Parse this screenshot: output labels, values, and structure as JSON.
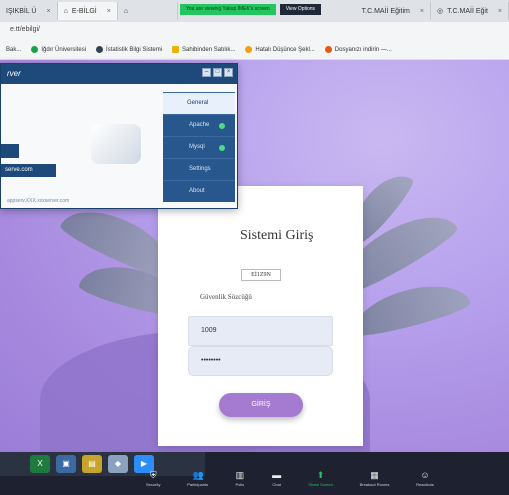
{
  "browser": {
    "tabs": [
      {
        "label": "IŞIKBİL Ü",
        "active": false
      },
      {
        "label": "E-BİLGİ",
        "active": true
      },
      {
        "label": "",
        "active": false
      },
      {
        "label": "T.C.MAİİ Eğitim",
        "active": false
      },
      {
        "label": "T.C.MAİİ Eğit",
        "active": false
      }
    ],
    "share_banner": {
      "message": "You are viewing Yakup İMEK's screen",
      "button": "View Options"
    },
    "url": "e.tt/ebilgi/",
    "bookmarks": [
      {
        "label": "Bak...",
        "color": "#1a73e8"
      },
      {
        "label": "Iğdır Üniversitesi",
        "color": "#16a34a"
      },
      {
        "label": "İstatistik Bilgi Sistemi",
        "color": "#334155"
      },
      {
        "label": "Sahibinden Satılık...",
        "color": "#eab308"
      },
      {
        "label": "Hatalı Düşünce Şekl...",
        "color": "#f59e0b"
      },
      {
        "label": "Dosyanızı indirin —...",
        "color": "#ea580c"
      }
    ]
  },
  "login": {
    "title": "Sistemi Giriş",
    "captcha": "Eİ1Z9N",
    "password_label": "Güvenlik Sözcüğü",
    "code_value": "1009",
    "password_value": "••••••••",
    "button": "GİRİŞ"
  },
  "app_window": {
    "title": "rver",
    "menu": [
      {
        "label": "General",
        "active": true,
        "status": false
      },
      {
        "label": "Apache",
        "active": false,
        "status": true
      },
      {
        "label": "Mysql",
        "active": false,
        "status": true
      },
      {
        "label": "Settings",
        "active": false,
        "status": false
      },
      {
        "label": "About",
        "active": false,
        "status": false
      }
    ],
    "link_text": "serve.com",
    "footer": "appserv.XXX.xxxserver.com"
  },
  "zoom_toolbar": [
    {
      "label": "Security",
      "icon": "shield-icon"
    },
    {
      "label": "Participants",
      "icon": "participants-icon",
      "count": "21"
    },
    {
      "label": "Polls",
      "icon": "polls-icon"
    },
    {
      "label": "Chat",
      "icon": "chat-icon"
    },
    {
      "label": "Share Screen",
      "icon": "share-screen-icon"
    },
    {
      "label": "Breakout Rooms",
      "icon": "breakout-icon"
    },
    {
      "label": "Reactions",
      "icon": "reactions-icon"
    }
  ],
  "taskbar_icons": [
    {
      "name": "excel-icon",
      "glyph": "X",
      "color": "#1f7a3e"
    },
    {
      "name": "photos-icon",
      "glyph": "▣",
      "color": "#3a6aa0"
    },
    {
      "name": "files-icon",
      "glyph": "▤",
      "color": "#c7a52c"
    },
    {
      "name": "app-icon",
      "glyph": "◆",
      "color": "#8aa2bf"
    },
    {
      "name": "zoom-icon",
      "glyph": "▶",
      "color": "#2d8cff"
    }
  ]
}
